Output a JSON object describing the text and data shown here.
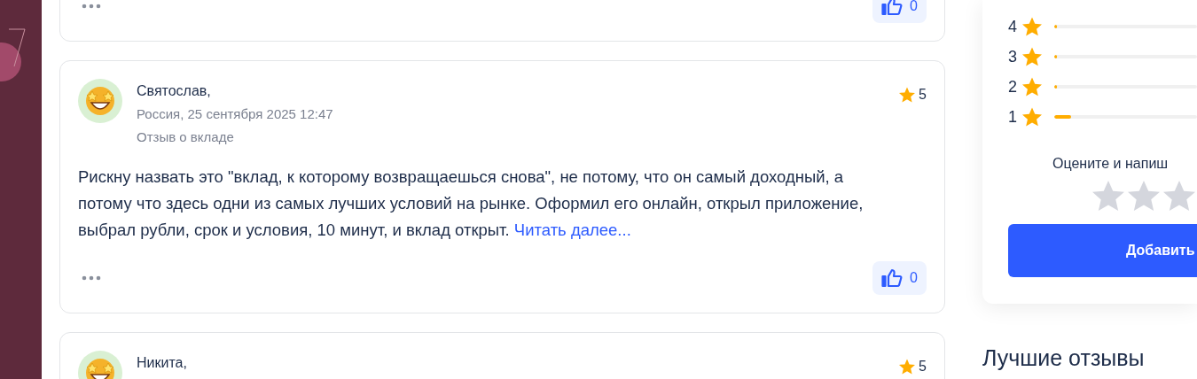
{
  "reviews": [
    {
      "likes": "0"
    },
    {
      "name": "Святослав,",
      "meta": "Россия, 25 сентября 2025 12:47",
      "subject": "Отзыв о вкладе",
      "rating": "5",
      "text": "Рискну назвать это \"вклад, к которому возвращаешься снова\", не потому, что он самый доходный, а потому что здесь одни из самых лучших условий на рынке. Оформил его онлайн, открыл приложение, выбрал рубли, срок и условия, 10 минут, и вклад открыт.",
      "read_more": "Читать далее...",
      "likes": "0"
    },
    {
      "name": "Никита,",
      "rating": "5"
    }
  ],
  "rating_summary": {
    "rows": [
      {
        "label": "4",
        "level": 0.015
      },
      {
        "label": "3",
        "level": 0.008
      },
      {
        "label": "2",
        "level": 0.008
      },
      {
        "label": "1",
        "level": 0.12
      }
    ],
    "prompt": "Оцените и напиш",
    "input_stars": [
      {
        "selected": false
      },
      {
        "selected": false
      },
      {
        "selected": false
      }
    ],
    "button": "Добавить"
  },
  "best_reviews_title": "Лучшие отзывы"
}
